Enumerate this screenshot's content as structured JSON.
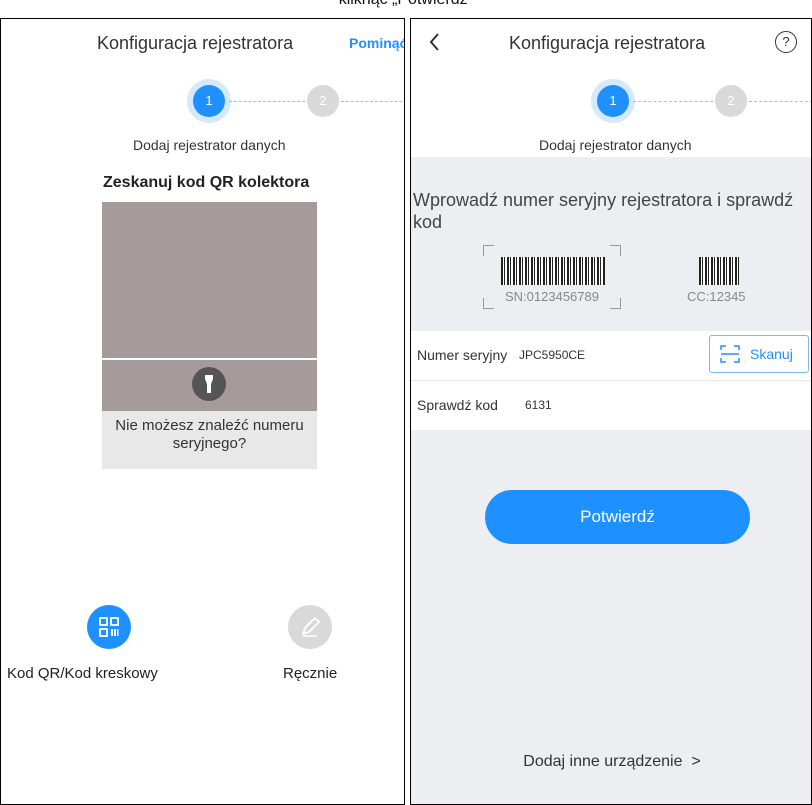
{
  "caption": "kliknąć „Potwierdź\"",
  "left": {
    "title": "Konfiguracja rejestratora",
    "skip": "Pominąć",
    "steps": [
      "1",
      "2"
    ],
    "step_label": "Dodaj rejestrator danych",
    "scan_heading": "Zeskanuj kod QR kolektora",
    "cant_find": "Nie możesz znaleźć numeru seryjnego?",
    "options": [
      {
        "label": "Kod QR/Kod kreskowy",
        "icon": "qr-code-icon"
      },
      {
        "label": "Ręcznie",
        "icon": "pencil-icon"
      }
    ],
    "colors": {
      "accent": "#1e90ff",
      "camera": "#a59b9c"
    }
  },
  "right": {
    "title": "Konfiguracja rejestratora",
    "steps": [
      "1",
      "2"
    ],
    "step_label": "Dodaj rejestrator danych",
    "instruction": "Wprowadź numer seryjny rejestratora i sprawdź kod",
    "sn_sample": "SN:0123456789",
    "cc_sample": "CC:12345",
    "serial_label": "Numer seryjny",
    "serial_value": "JPC5950CE",
    "scan_button": "Skanuj",
    "check_label": "Sprawdź kod",
    "check_value": "6131",
    "confirm": "Potwierdź",
    "add_other": "Dodaj inne urządzenie  >"
  }
}
